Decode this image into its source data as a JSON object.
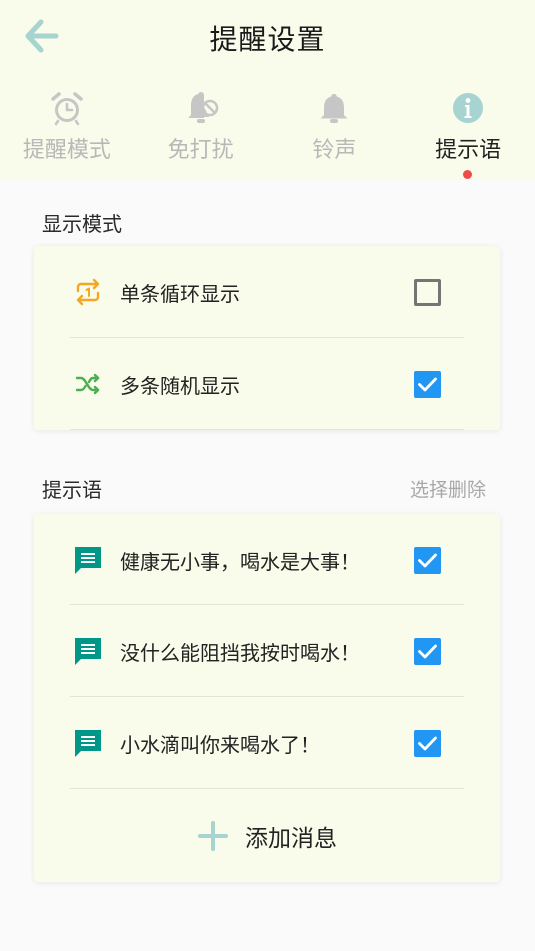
{
  "header": {
    "title": "提醒设置",
    "back_icon": "arrow-left-icon",
    "accent_color": "#a7d3d0"
  },
  "tabs": [
    {
      "label": "提醒模式",
      "icon": "alarm-clock-icon",
      "active": false
    },
    {
      "label": "免打扰",
      "icon": "bell-off-icon",
      "active": false
    },
    {
      "label": "铃声",
      "icon": "bell-icon",
      "active": false
    },
    {
      "label": "提示语",
      "icon": "info-icon",
      "active": true
    }
  ],
  "display_mode": {
    "title": "显示模式",
    "options": [
      {
        "label": "单条循环显示",
        "icon": "repeat-one-icon",
        "icon_color": "#f5a623",
        "checked": false
      },
      {
        "label": "多条随机显示",
        "icon": "shuffle-icon",
        "icon_color": "#4caf50",
        "checked": true
      }
    ]
  },
  "tips": {
    "title": "提示语",
    "action_label": "选择删除",
    "items": [
      {
        "text": "健康无小事，喝水是大事！",
        "icon": "message-icon",
        "checked": true
      },
      {
        "text": "没什么能阻挡我按时喝水！",
        "icon": "message-icon",
        "checked": true
      },
      {
        "text": "小水滴叫你来喝水了！",
        "icon": "message-icon",
        "checked": true
      }
    ],
    "add_label": "添加消息"
  },
  "colors": {
    "header_bg": "#f9fbeb",
    "checkbox_on": "#2196f3",
    "message_icon": "#009688",
    "tab_indicator": "#ef4b4b"
  }
}
